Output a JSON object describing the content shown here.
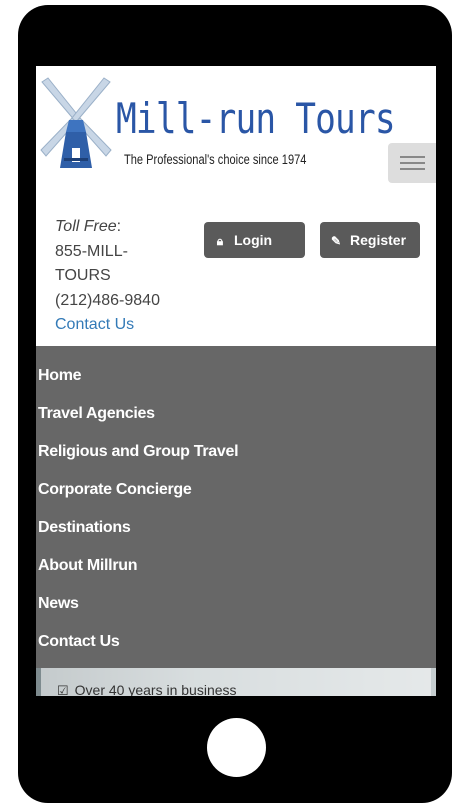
{
  "header": {
    "brand_name": "Mill-run Tours",
    "tagline": "The Professional's choice since 1974",
    "menu_toggle_icon": "hamburger-menu-icon"
  },
  "contact": {
    "toll_free_label": "Toll Free",
    "toll_free_suffix": ":",
    "phone_line1": "855-MILL-",
    "phone_line2": "TOURS",
    "phone_alt": "(212)486-9840",
    "contact_link": "Contact Us"
  },
  "auth": {
    "login_label": "Login",
    "login_icon": "lock-icon",
    "register_label": "Register",
    "register_icon": "edit-icon"
  },
  "nav": {
    "items": [
      "Home",
      "Travel Agencies",
      "Religious and Group Travel",
      "Corporate Concierge",
      "Destinations",
      "About Millrun",
      "News",
      "Contact Us"
    ]
  },
  "hero": {
    "feature_text": "Over 40 years in business",
    "feature_icon": "checkbox-icon"
  },
  "colors": {
    "brand_blue": "#2a56a6",
    "nav_bg": "#676767",
    "button_bg": "#5a5a5a",
    "link_blue": "#337ab7"
  }
}
